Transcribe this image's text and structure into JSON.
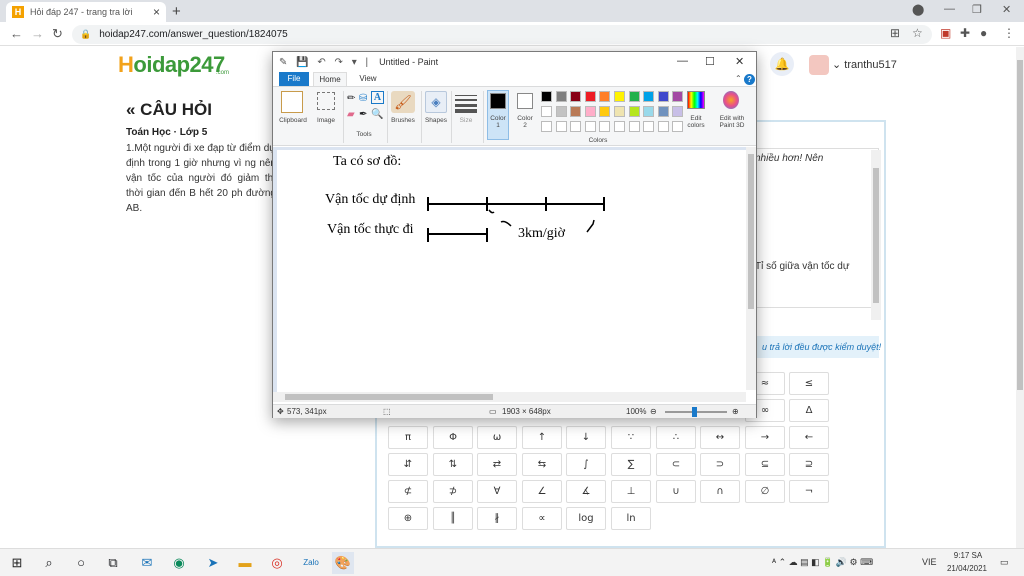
{
  "browser": {
    "tab_title": "Hỏi đáp 247 - trang tra lời",
    "tab_close": "×",
    "new_tab": "+",
    "url": "hoidap247.com/answer_question/1824075",
    "back": "←",
    "forward": "→",
    "reload": "↻",
    "min": "—",
    "max": "❐",
    "close": "✕"
  },
  "site": {
    "logo_h": "H",
    "logo_rest": "oidap247",
    "logo_sub": ".com",
    "username": "tranthu517",
    "heading": "« CÂU HỎI",
    "subject": "Toán Học · Lớp 5",
    "question_text": "1.Một người đi xe đạp từ điểm dự định trong 1 giờ nhưng vì ng nên vận tốc của người đó giảm thì thời gian đến B hết 20 ph đường AB.",
    "answer_snippet_1": "nhiều hơn! Nên",
    "answer_snippet_2": "Tỉ số giữa vận tốc dự",
    "notice": "u trả lời đều được kiểm duyệt!",
    "symbols": [
      [
        "≈",
        "≤"
      ],
      [
        "∞",
        "Δ"
      ],
      [
        "π",
        "Φ",
        "ω",
        "↑",
        "↓",
        "∵",
        "∴",
        "↔",
        "→",
        "←"
      ],
      [
        "⇵",
        "⇅",
        "⇄",
        "⇆",
        "∫",
        "∑",
        "⊂",
        "⊃",
        "⊆",
        "⊇"
      ],
      [
        "⊄",
        "⊅",
        "∀",
        "∠",
        "∡",
        "⊥",
        "∪",
        "∩",
        "∅",
        "¬"
      ],
      [
        "⊕",
        "║",
        "∦",
        "∝",
        "log",
        "ln"
      ]
    ]
  },
  "paint": {
    "title": "Untitled - Paint",
    "min": "—",
    "max": "☐",
    "close": "✕",
    "tab_file": "File",
    "tab_home": "Home",
    "tab_view": "View",
    "help": "?",
    "groups": {
      "clipboard": "Clipboard",
      "image": "Image",
      "tools": "Tools",
      "brushes": "Brushes",
      "shapes": "Shapes",
      "size": "Size",
      "color1": "Color\n1",
      "color2": "Color\n2",
      "colors": "Colors",
      "edit_colors": "Edit\ncolors",
      "edit_paint3d": "Edit with\nPaint 3D"
    },
    "palette": [
      "#000000",
      "#7f7f7f",
      "#880015",
      "#ed1c24",
      "#ff7f27",
      "#fff200",
      "#22b14c",
      "#00a2e8",
      "#3f48cc",
      "#a349a4",
      "#ffffff",
      "#c3c3c3",
      "#b97a57",
      "#ffaec9",
      "#ffc90e",
      "#efe4b0",
      "#b5e61d",
      "#99d9ea",
      "#7092be",
      "#c8bfe7"
    ],
    "canvas_text": {
      "title": "Ta có sơ đồ:",
      "label_planned": "Vận tốc dự định",
      "label_actual": "Vận tốc thực đi",
      "speed": "3km/giờ"
    },
    "status": {
      "cursor": "573, 341px",
      "canvas_size": "1903 × 648px",
      "zoom": "100%"
    }
  },
  "taskbar": {
    "time": "9:17 SA",
    "date": "21/04/2021",
    "lang": "VIE"
  }
}
